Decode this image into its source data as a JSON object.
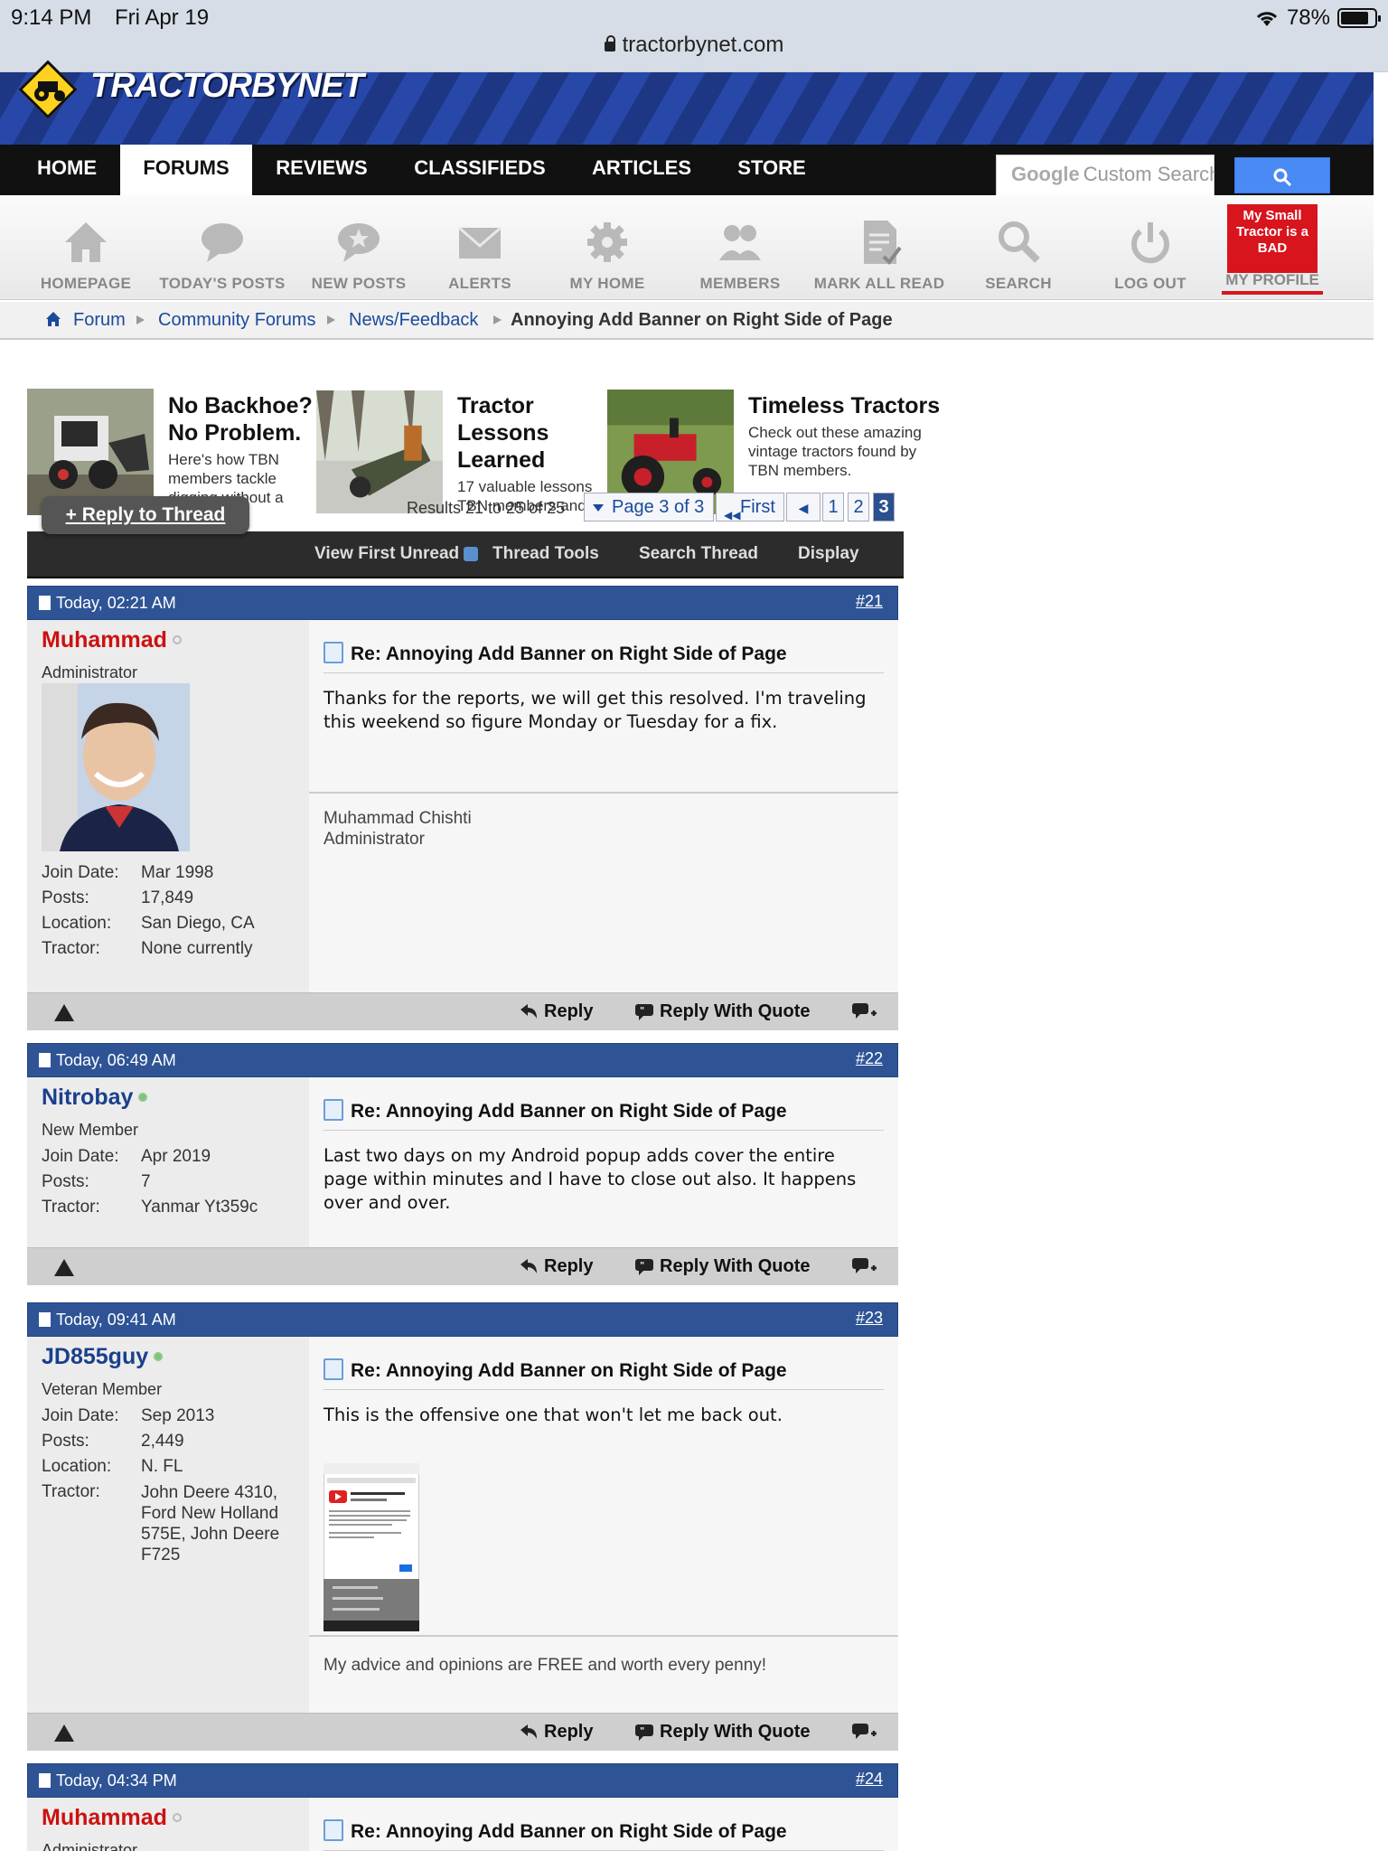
{
  "status": {
    "time": "9:14 PM",
    "date": "Fri Apr 19",
    "battery": "78%"
  },
  "url": "tractorbynet.com",
  "brand": {
    "name": "TRACTORBYNET"
  },
  "nav": {
    "items": [
      "HOME",
      "FORUMS",
      "REVIEWS",
      "CLASSIFIEDS",
      "ARTICLES",
      "STORE"
    ],
    "active": "FORUMS"
  },
  "search": {
    "brand": "Google",
    "placeholder": "Custom Search"
  },
  "toolbar": {
    "items": [
      "HOMEPAGE",
      "TODAY'S POSTS",
      "NEW POSTS",
      "ALERTS",
      "MY HOME",
      "MEMBERS",
      "MARK ALL READ",
      "SEARCH",
      "LOG OUT"
    ],
    "profile_box": "My Small Tractor is a BAD",
    "profile_label": "MY PROFILE"
  },
  "breadcrumb": [
    "Forum",
    "Community Forums",
    "News/Feedback",
    "Annoying Add Banner on Right Side of Page"
  ],
  "ads": [
    {
      "title": "No Backhoe? No Problem.",
      "text": "Here's how TBN members tackle digging without a backhoe."
    },
    {
      "title": "Tractor Lessons Learned",
      "text": "17 valuable lessons TBN members and the lessons they learned."
    },
    {
      "title": "Timeless Tractors",
      "text": "Check out these amazing vintage tractors found by TBN members."
    }
  ],
  "thread": {
    "reply_button": "+ Reply to Thread",
    "results": "Results 21 to 25 of 25",
    "page_label": "Page 3 of 3",
    "first_label": "First",
    "pages": [
      "1",
      "2",
      "3"
    ],
    "tools": [
      "View First Unread",
      "Thread Tools",
      "Search Thread",
      "Display"
    ]
  },
  "posts": [
    {
      "date": "Today, 02:21 AM",
      "num": "#21",
      "user": "Muhammad",
      "role": "Administrator",
      "title": "Re: Annoying Add Banner on Right Side of Page",
      "body": "Thanks for the reports, we will get this resolved. I'm traveling this weekend so figure Monday or Tuesday for a fix.",
      "sig": "Muhammad Chishti\nAdministrator",
      "info": [
        [
          "Join Date:",
          "Mar 1998"
        ],
        [
          "Posts:",
          "17,849"
        ],
        [
          "Location:",
          "San Diego, CA"
        ],
        [
          "Tractor:",
          "None currently"
        ]
      ]
    },
    {
      "date": "Today, 06:49 AM",
      "num": "#22",
      "user": "Nitrobay",
      "role": "New Member",
      "title": "Re: Annoying Add Banner on Right Side of Page",
      "body": "Last two days on my Android popup adds cover the entire page within minutes and I have to close out also. It happens over and over.",
      "info": [
        [
          "Join Date:",
          "Apr 2019"
        ],
        [
          "Posts:",
          "7"
        ],
        [
          "Tractor:",
          "Yanmar Yt359c"
        ]
      ]
    },
    {
      "date": "Today, 09:41 AM",
      "num": "#23",
      "user": "JD855guy",
      "role": "Veteran Member",
      "title": "Re: Annoying Add Banner on Right Side of Page",
      "body": "This is the offensive one that won't let me back out.",
      "sig": "My advice and opinions are FREE and worth every penny!",
      "info": [
        [
          "Join Date:",
          "Sep 2013"
        ],
        [
          "Posts:",
          "2,449"
        ],
        [
          "Location:",
          "N. FL"
        ],
        [
          "Tractor:",
          "John Deere 4310, Ford New Holland 575E, John Deere F725"
        ]
      ]
    },
    {
      "date": "Today, 04:34 PM",
      "num": "#24",
      "user": "Muhammad",
      "role": "Administrator",
      "title": "Re: Annoying Add Banner on Right Side of Page"
    }
  ],
  "footer_actions": {
    "reply": "Reply",
    "reply_quote": "Reply With Quote"
  },
  "colors": {
    "nav_bg": "#111111",
    "header_blue": "#2e5496",
    "admin_name": "#cc1111",
    "member_name": "#1a3f8c",
    "profile_red": "#d8141d",
    "google_blue": "#4a8af4"
  }
}
